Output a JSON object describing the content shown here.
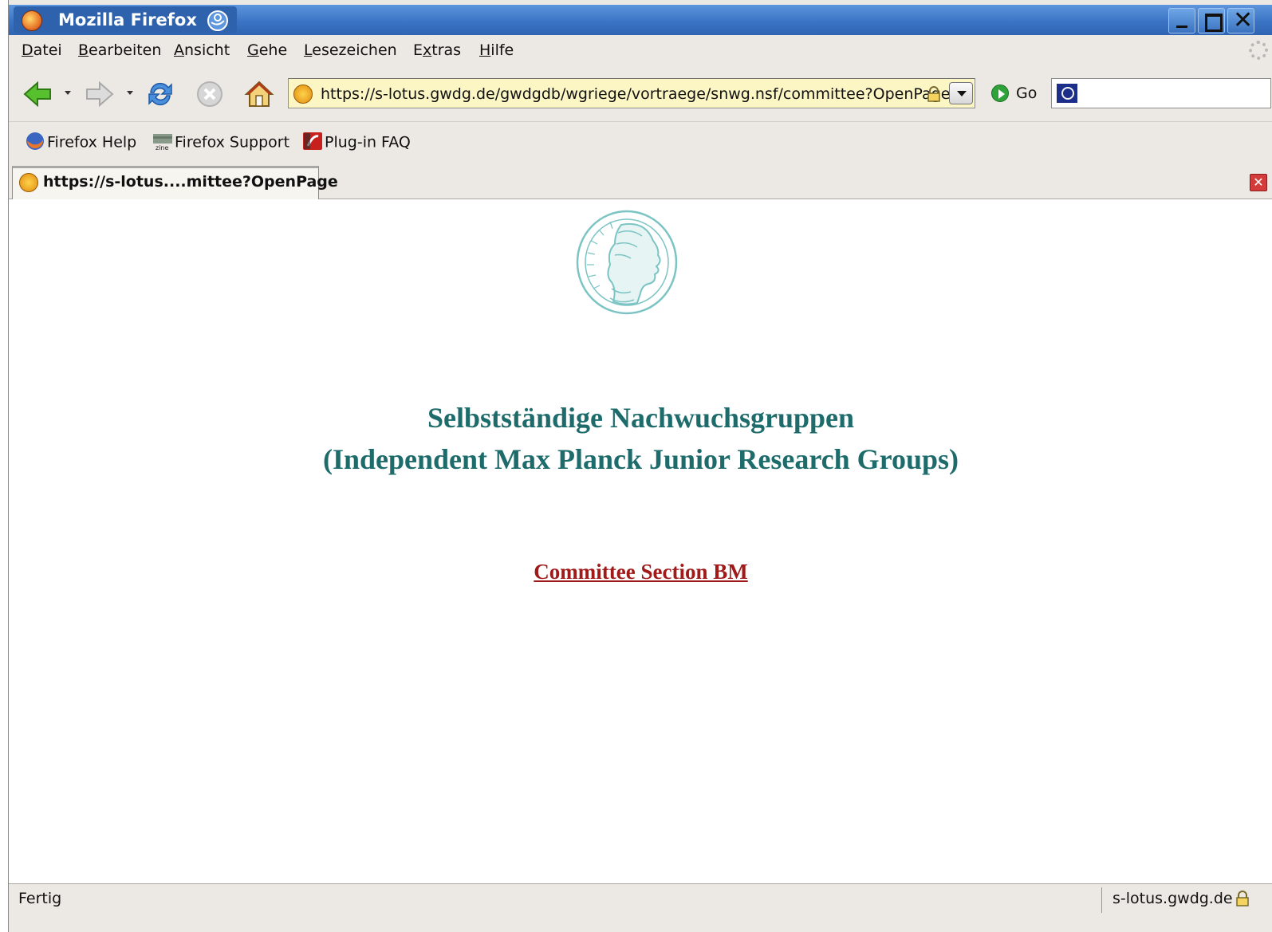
{
  "window": {
    "title": "Mozilla Firefox"
  },
  "menubar": {
    "items": [
      {
        "accel": "D",
        "rest": "atei"
      },
      {
        "accel": "B",
        "rest": "earbeiten"
      },
      {
        "accel": "A",
        "rest": "nsicht"
      },
      {
        "accel": "G",
        "rest": "ehe"
      },
      {
        "accel": "L",
        "rest": "esezeichen"
      },
      {
        "pre": "E",
        "accel": "x",
        "rest": "tras"
      },
      {
        "accel": "H",
        "rest": "ilfe"
      }
    ]
  },
  "navbar": {
    "url": "https://s-lotus.gwdg.de/gwdgdb/wgriege/vortraege/snwg.nsf/committee?OpenPage",
    "go_label": "Go",
    "search_value": ""
  },
  "bookmarks": {
    "items": [
      {
        "label": "Firefox Help",
        "icon": "firefox-icon"
      },
      {
        "label": "Firefox Support",
        "icon": "zine-icon"
      },
      {
        "label": "Plug-in FAQ",
        "icon": "plugin-icon"
      }
    ]
  },
  "tabs": [
    {
      "label": "https://s-lotus....mittee?OpenPage"
    }
  ],
  "content": {
    "heading_line1": "Selbstständige Nachwuchsgruppen",
    "heading_line2": "(Independent Max Planck Junior Research Groups)",
    "link_label": "Committee Section BM",
    "heading_color": "#1e6b6b",
    "link_color": "#a01a1a"
  },
  "statusbar": {
    "status": "Fertig",
    "host": "s-lotus.gwdg.de"
  }
}
